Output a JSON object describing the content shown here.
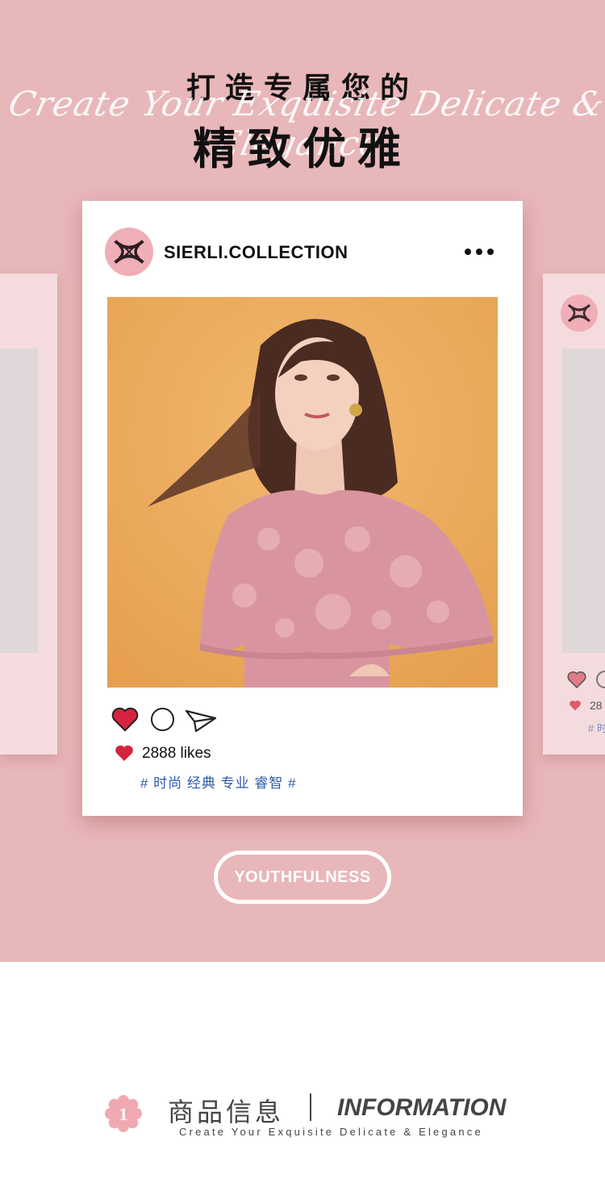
{
  "header": {
    "title_top": "打造专属您的",
    "script_text": "Create Your Exquisite Delicate & Elegance",
    "title_main": "精致优雅"
  },
  "post": {
    "username": "SIERLI.COLLECTION",
    "likes_text": "2888 likes",
    "tags_text": "# 时尚 经典 专业 睿智 #",
    "logo_icon": "sierli-logo",
    "colors": {
      "heart": "#d5233f",
      "tags": "#2f5aa8",
      "avatar_bg": "#f0aeb7"
    }
  },
  "side_card_right": {
    "likes_text": "28",
    "tags_text": "# 时"
  },
  "badge": {
    "label": "YOUTHFULNESS"
  },
  "info": {
    "number": "1",
    "title_cn": "商品信息",
    "title_en": "INFORMATION",
    "subtitle": "Create Your Exquisite Delicate & Elegance"
  },
  "theme": {
    "hero_bg": "#e8b7b9",
    "side_card_bg": "#f4dcde"
  }
}
